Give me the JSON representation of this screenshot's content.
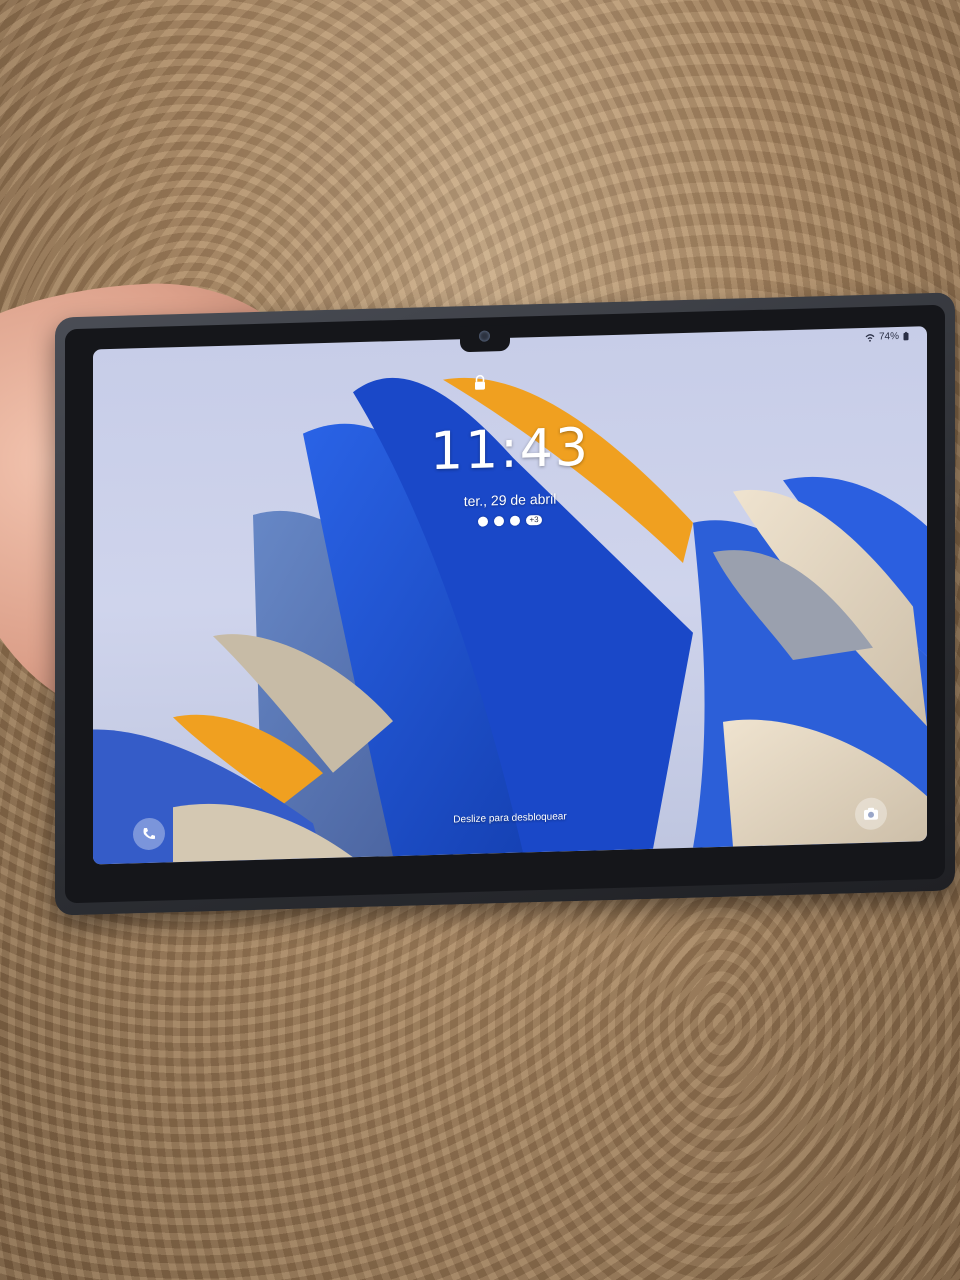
{
  "status_bar": {
    "battery": "74%"
  },
  "lockscreen": {
    "time": "11:43",
    "date": "ter., 29 de abril",
    "notification_badge": "+3",
    "swipe_hint": "Deslize para desbloquear"
  },
  "icons": [
    "lock-icon",
    "phone-shortcut-icon",
    "camera-shortcut-icon",
    "wifi-icon",
    "battery-icon"
  ],
  "colors": {
    "wallpaper_blue": "#1d4fd0",
    "wallpaper_orange": "#f0a020",
    "wallpaper_sky": "#c7cde8"
  }
}
